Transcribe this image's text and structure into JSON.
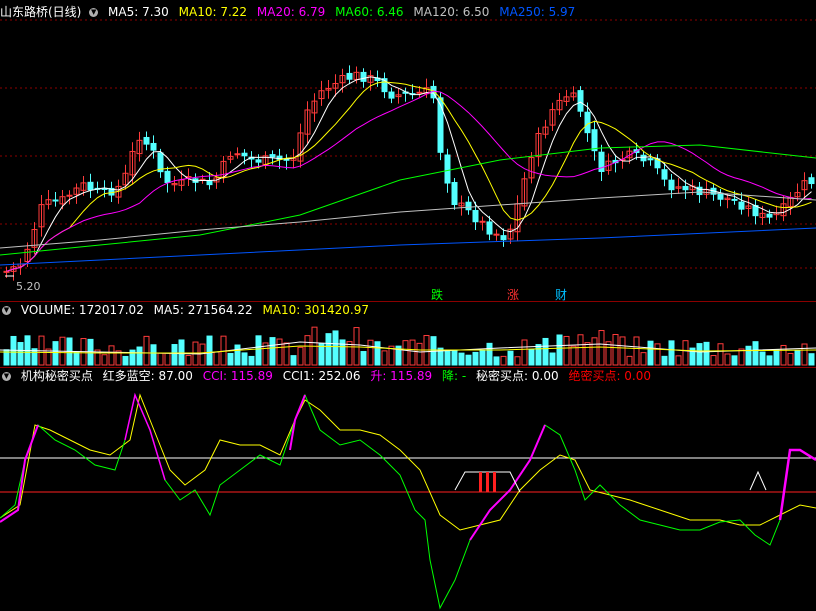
{
  "price_panel": {
    "title": "山东路桥(日线)",
    "ma": [
      {
        "label": "MA5: 7.30",
        "color": "#ffffff"
      },
      {
        "label": "MA10: 7.22",
        "color": "#ffff00"
      },
      {
        "label": "MA20: 6.79",
        "color": "#ff00ff"
      },
      {
        "label": "MA60: 6.46",
        "color": "#00ff00"
      },
      {
        "label": "MA120: 6.50",
        "color": "#c0c0c0"
      },
      {
        "label": "MA250: 5.97",
        "color": "#0055ff"
      }
    ],
    "low_label": "5.20",
    "signals": [
      {
        "text": "跌",
        "color": "#00ff00"
      },
      {
        "text": "涨",
        "color": "#ff3030"
      },
      {
        "text": "财",
        "color": "#00bfff"
      }
    ]
  },
  "volume_panel": {
    "items": [
      {
        "label": "VOLUME: 172017.02",
        "color": "#ffffff"
      },
      {
        "label": "MA5: 271564.22",
        "color": "#ffffff"
      },
      {
        "label": "MA10: 301420.97",
        "color": "#ffff00"
      }
    ]
  },
  "indicator_panel": {
    "items": [
      {
        "label": "机构秘密买点",
        "color": "#ffffff"
      },
      {
        "label": "红多蓝空: 87.00",
        "color": "#ffffff"
      },
      {
        "label": "CCI: 115.89",
        "color": "#ff00ff"
      },
      {
        "label": "CCI1: 252.06",
        "color": "#ffffff"
      },
      {
        "label": "升: 115.89",
        "color": "#ff00ff"
      },
      {
        "label": "降: -",
        "color": "#00ff00"
      },
      {
        "label": "秘密买点: 0.00",
        "color": "#ffffff"
      },
      {
        "label": "绝密买点: 0.00",
        "color": "#ff0000"
      }
    ]
  },
  "colors": {
    "up": "#ff3b3b",
    "down": "#54ffff",
    "grid": "#8b0000"
  }
}
